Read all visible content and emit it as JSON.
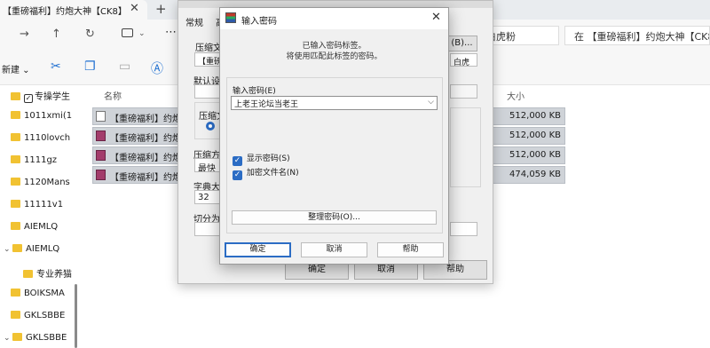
{
  "explorer": {
    "tab_title": "【重磅福利】约炮大神【CK8】",
    "tab_close": "✕",
    "tab_new": "+",
    "nav": {
      "forward": "→",
      "up": "↑",
      "refresh": "↻",
      "more": "⋯"
    },
    "address_fragment": "脸，白虎粉",
    "search_text": "在 【重磅福利】约炮大神【CK8",
    "cmd_new": "新建",
    "sidebar": [
      {
        "label": "专操学生",
        "checkbox": true
      },
      {
        "label": "1011xmi(1"
      },
      {
        "label": "1110lovch"
      },
      {
        "label": "1111gz"
      },
      {
        "label": "1120Mans"
      },
      {
        "label": "11111v1"
      },
      {
        "label": "AIEMLQ"
      },
      {
        "label": "AIEMLQ",
        "expanded": true
      },
      {
        "label": "专业养猫"
      },
      {
        "label": "BOIKSMA"
      },
      {
        "label": "GKLSBBE"
      },
      {
        "label": "GKLSBBE",
        "expanded": true
      }
    ],
    "columns": {
      "name": "名称",
      "size": "大小"
    },
    "files": [
      {
        "name": "【重磅福利】约炮",
        "size": "512,000 KB",
        "type": "doc"
      },
      {
        "name": "【重磅福利】约炮",
        "size": "512,000 KB",
        "type": "rar"
      },
      {
        "name": "【重磅福利】约炮",
        "size": "512,000 KB",
        "type": "rar"
      },
      {
        "name": "【重磅福利】约炮",
        "size": "474,059 KB",
        "type": "rar"
      }
    ]
  },
  "archive_dialog": {
    "tabs": [
      "常规",
      "高"
    ],
    "archive_name_label": "压缩文件",
    "archive_name_value": "【重磅",
    "browse_label": "(B)...",
    "profile_fragment": "白虎",
    "default_label": "默认设置",
    "format_label": "压缩文件",
    "method_label": "压缩方",
    "method_value": "最快",
    "dict_label": "字典大小",
    "dict_value": "32",
    "split_label": "切分为分",
    "ok": "确定",
    "cancel": "取消",
    "help": "帮助"
  },
  "password_dialog": {
    "title": "输入密码",
    "close": "✕",
    "message_1": "已输入密码标签。",
    "message_2": "将使用匹配此标签的密码。",
    "password_label": "输入密码(E)",
    "password_value": "上老王论坛当老王",
    "dropdown_icon": "⌵",
    "show_password": "显示密码(S)",
    "encrypt_filenames": "加密文件名(N)",
    "check_mark": "✓",
    "manage": "整理密码(O)...",
    "ok": "确定",
    "cancel": "取消",
    "help": "帮助"
  }
}
